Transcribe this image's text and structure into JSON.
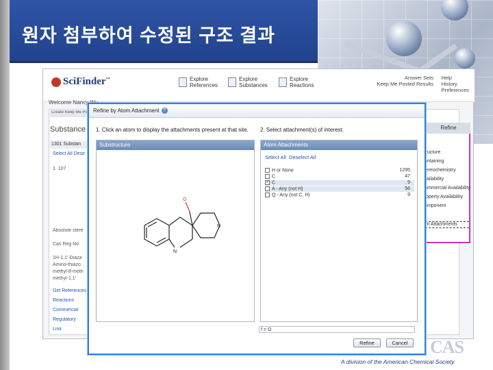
{
  "slide": {
    "title": "원자 첨부하여 수정된 구조 결과",
    "footer_text": "A division of the American Chemical Society",
    "footer_logo": "CAS",
    "title_bar_color": "#2a4d9e",
    "accent_border_color": "#2c7fe0",
    "highlight_box_color": "#c832b4"
  },
  "scifinder": {
    "logo": "SciFinder",
    "logo_tm": "™",
    "explore": [
      {
        "label": "Explore\nReferences",
        "icon": "document-icon"
      },
      {
        "label": "Explore\nSubstances",
        "icon": "flask-icon"
      },
      {
        "label": "Explore\nReactions",
        "icon": "reaction-icon"
      }
    ],
    "top_links_left": "Answer Sets\nKeep Me Posted Results",
    "top_links_right": "Help\nHistory\nPreferences",
    "welcome": "Welcome Nancy Wu",
    "tab_label": "Create Keep Me Post",
    "subtitle": "Substance",
    "count": "1301 Substan",
    "select_all": "Select All  Dese",
    "item_number": "1. 107",
    "bg_texts": [
      "Absolute stere",
      "Cas Reg No",
      "1H-1,1'-Diaza",
      "Amino-thiazo",
      "methyl-8-meth",
      "methyl-1,1'"
    ],
    "bg_links": [
      "Get References",
      "Reactions",
      "Commercial",
      "Regulatory",
      "Link"
    ],
    "refine_tab": "Refine",
    "refine_items": [
      "Structure",
      "Containing",
      "Stereochemistry",
      "Availability",
      "Commercial Availability",
      "Property Availability",
      "Component"
    ],
    "refine_selected": "Atom Attachments"
  },
  "dialog": {
    "title": "Refine by Atom Attachment",
    "step1": "1. Click an atom to display the attachments present at that site.",
    "step2": "2. Select attachment(s) of interest.",
    "left_header": "Substructure",
    "right_header": "Atom Attachments",
    "select_all": "Select All",
    "deselect_all": "Deselect All",
    "attachments": [
      {
        "label": "H or None",
        "count": "1295",
        "checked": false,
        "highlight": false
      },
      {
        "label": "C",
        "count": "47",
        "checked": false,
        "highlight": false
      },
      {
        "label": "C",
        "count": "9",
        "checked": true,
        "highlight": true
      },
      {
        "label": "A - Any (not H)",
        "count": "56",
        "checked": false,
        "highlight": true
      },
      {
        "label": "Q - Any (not C, H)",
        "count": "9",
        "checked": false,
        "highlight": false
      }
    ],
    "status_value": "f = O",
    "refine_button": "Refine",
    "cancel_button": "Cancel"
  }
}
